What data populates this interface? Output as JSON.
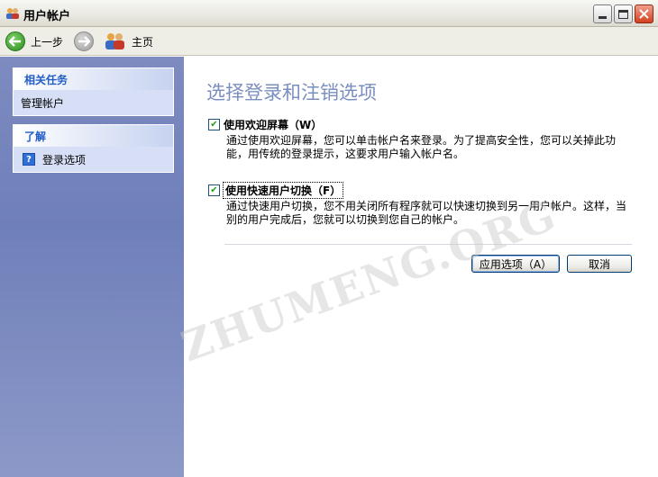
{
  "window": {
    "title": "用户帐户"
  },
  "toolbar": {
    "back_label": "上一步",
    "home_label": "主页"
  },
  "sidebar": {
    "related_tasks": {
      "heading": "相关任务",
      "items": [
        {
          "label": "管理帐户"
        }
      ]
    },
    "learn_about": {
      "heading": "了解",
      "items": [
        {
          "label": "登录选项",
          "icon": "help-icon"
        }
      ]
    }
  },
  "main": {
    "title": "选择登录和注销选项",
    "options": [
      {
        "label": "使用欢迎屏幕（W）",
        "checked": true,
        "description_line1": "通过使用欢迎屏幕，您可以单击帐户名来登录。为了提高安全性，您可以关掉此功",
        "description_line2": "能，用传统的登录提示，这要求用户输入帐户名。"
      },
      {
        "label": "使用快速用户切换（F）",
        "checked": true,
        "description_line1": "通过快速用户切换，您不用关闭所有程序就可以快速切换到另一用户帐户。这样，当",
        "description_line2": "别的用户完成后，您就可以切换到您自己的帐户。"
      }
    ],
    "apply_label": "应用选项（A）",
    "cancel_label": "取消"
  },
  "watermark": "ZHUMENG.ORG"
}
